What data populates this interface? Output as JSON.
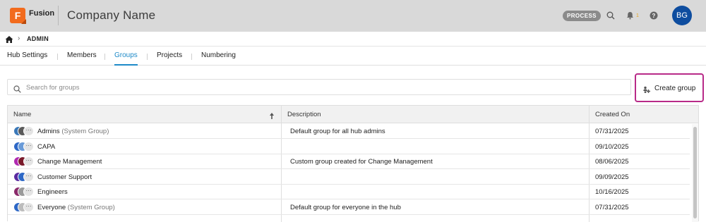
{
  "header": {
    "app_name": "Fusion",
    "logo_letter": "F",
    "company_name": "Company Name",
    "process_badge": "PROCESS",
    "notification_count": "1",
    "user_initials": "BG",
    "accent_color": "#0e4d9f",
    "logo_color": "#f26b1d"
  },
  "breadcrumb": {
    "home_icon": "home-icon",
    "separator": "›",
    "current": "ADMIN"
  },
  "tabs": [
    {
      "label": "Hub Settings",
      "active": false
    },
    {
      "label": "Members",
      "active": false
    },
    {
      "label": "Groups",
      "active": true
    },
    {
      "label": "Projects",
      "active": false
    },
    {
      "label": "Numbering",
      "active": false
    }
  ],
  "search": {
    "placeholder": "Search for groups",
    "value": ""
  },
  "create_button": {
    "label": "Create group",
    "highlight_color": "#b82a88"
  },
  "table": {
    "columns": {
      "name": "Name",
      "description": "Description",
      "created_on": "Created On"
    },
    "sort_direction": "ascending",
    "rows": [
      {
        "name": "Admins",
        "system_tag": "(System Group)",
        "description": "Default group for all hub admins",
        "created_on": "07/31/2025",
        "colors": [
          "#3a78b8",
          "#5a5a5a"
        ]
      },
      {
        "name": "CAPA",
        "system_tag": "",
        "description": "",
        "created_on": "09/10/2025",
        "colors": [
          "#2e68c6",
          "#6a9bd8"
        ]
      },
      {
        "name": "Change Management",
        "system_tag": "",
        "description": "Custom group created for Change Management",
        "created_on": "08/06/2025",
        "colors": [
          "#b02ab0",
          "#7a1a2a"
        ]
      },
      {
        "name": "Customer Support",
        "system_tag": "",
        "description": "",
        "created_on": "09/09/2025",
        "colors": [
          "#5a2aa0",
          "#2e68c6"
        ]
      },
      {
        "name": "Engineers",
        "system_tag": "",
        "description": "",
        "created_on": "10/16/2025",
        "colors": [
          "#8a2a6a",
          "#9a9a9a"
        ]
      },
      {
        "name": "Everyone",
        "system_tag": "(System Group)",
        "description": "Default group for everyone in the hub",
        "created_on": "07/31/2025",
        "colors": [
          "#2e68c6",
          "#bcbcbc"
        ]
      }
    ]
  }
}
